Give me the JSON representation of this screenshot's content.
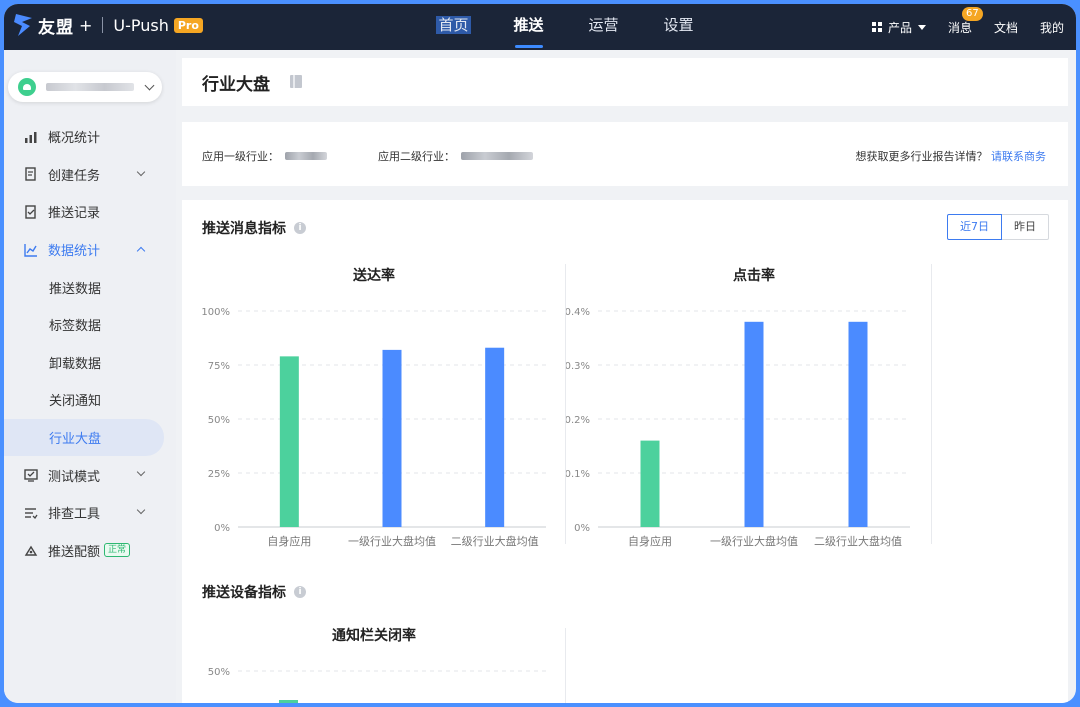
{
  "topbar": {
    "brand": "友盟",
    "brand_plus": "+",
    "product": "U-Push",
    "badge": "Pro",
    "nav": [
      {
        "label": "首页"
      },
      {
        "label": "推送"
      },
      {
        "label": "运营"
      },
      {
        "label": "设置"
      }
    ],
    "products_label": "产品",
    "messages_label": "消息",
    "messages_count": "67",
    "docs_label": "文档",
    "mine_label": "我的"
  },
  "sidebar": {
    "items": [
      {
        "label": "概况统计",
        "icon": "bar-chart-icon"
      },
      {
        "label": "创建任务",
        "icon": "task-icon"
      },
      {
        "label": "推送记录",
        "icon": "record-icon"
      },
      {
        "label": "数据统计",
        "icon": "line-chart-icon"
      },
      {
        "label": "推送数据"
      },
      {
        "label": "标签数据"
      },
      {
        "label": "卸载数据"
      },
      {
        "label": "关闭通知"
      },
      {
        "label": "行业大盘"
      },
      {
        "label": "测试模式",
        "icon": "test-icon"
      },
      {
        "label": "排查工具",
        "icon": "tool-icon"
      },
      {
        "label": "推送配额",
        "icon": "quota-icon",
        "tag": "正常"
      }
    ]
  },
  "page": {
    "title": "行业大盘",
    "filter1_label": "应用一级行业：",
    "filter2_label": "应用二级行业：",
    "contact_text": "想获取更多行业报告详情？",
    "contact_link": "请联系商务",
    "section1_title": "推送消息指标",
    "section2_title": "推送设备指标",
    "toggle_7d": "近7日",
    "toggle_yesterday": "昨日"
  },
  "colors": {
    "own": "#4cd19d",
    "industry": "#4b8bff",
    "accent": "#3d7bf0"
  },
  "chart_data": [
    {
      "type": "bar",
      "title": "送达率",
      "categories": [
        "自身应用",
        "一级行业大盘均值",
        "二级行业大盘均值"
      ],
      "values": [
        79,
        82,
        83
      ],
      "unit": "%",
      "ylim": [
        0,
        100
      ],
      "yticks": [
        "0%",
        "25%",
        "50%",
        "75%",
        "100%"
      ],
      "grid": true
    },
    {
      "type": "bar",
      "title": "点击率",
      "categories": [
        "自身应用",
        "一级行业大盘均值",
        "二级行业大盘均值"
      ],
      "values": [
        0.16,
        0.38,
        0.38
      ],
      "unit": "%",
      "ylim": [
        0,
        0.4
      ],
      "yticks": [
        "0%",
        "0.1%",
        "0.2%",
        "0.3%",
        "0.4%"
      ],
      "grid": true
    },
    {
      "type": "bar",
      "title": "通知栏关闭率",
      "yticks": [
        "50%"
      ],
      "grid": true
    }
  ]
}
